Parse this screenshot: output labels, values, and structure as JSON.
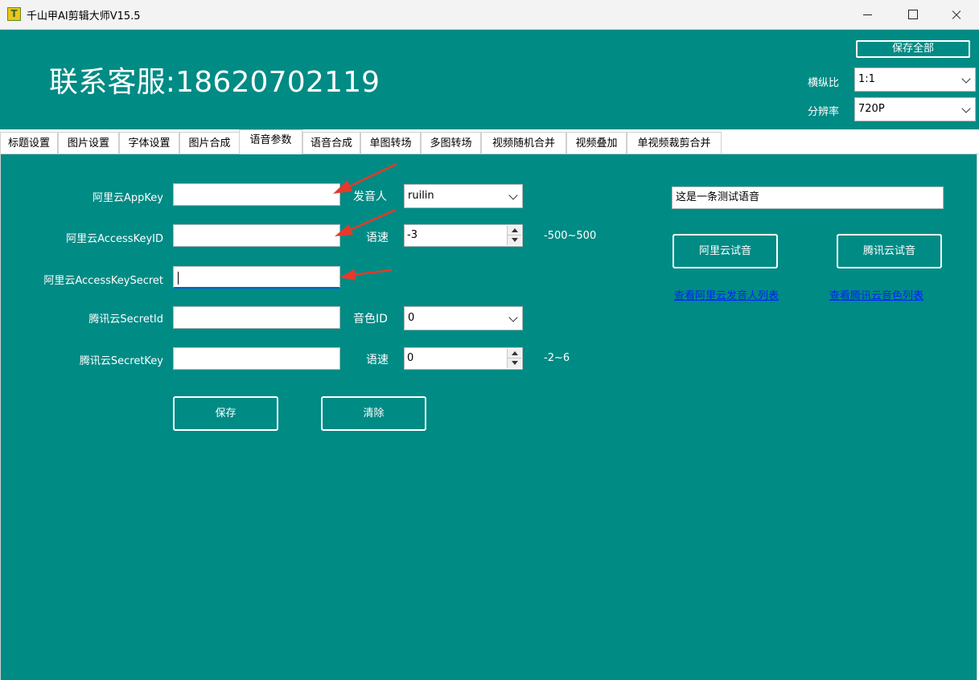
{
  "window": {
    "title": "千山甲AI剪辑大师V15.5",
    "icon_letter": "T"
  },
  "header": {
    "contact": "联系客服:18620702119",
    "save_all_label": "保存全部",
    "aspect_label": "横纵比",
    "aspect_value": "1:1",
    "resolution_label": "分辨率",
    "resolution_value": "720P"
  },
  "tabs": [
    {
      "label": "标题设置",
      "active": false
    },
    {
      "label": "图片设置",
      "active": false
    },
    {
      "label": "字体设置",
      "active": false
    },
    {
      "label": "图片合成",
      "active": false
    },
    {
      "label": "语音参数",
      "active": true
    },
    {
      "label": "语音合成",
      "active": false
    },
    {
      "label": "单图转场",
      "active": false
    },
    {
      "label": "多图转场",
      "active": false
    },
    {
      "label": "视频随机合并",
      "active": false
    },
    {
      "label": "视频叠加",
      "active": false
    },
    {
      "label": "单视频裁剪合并",
      "active": false
    }
  ],
  "form": {
    "aliyun_appkey_label": "阿里云AppKey",
    "aliyun_appkey_value": "",
    "aliyun_accesskeyid_label": "阿里云AccessKeyID",
    "aliyun_accesskeyid_value": "",
    "aliyun_accesskeysecret_label": "阿里云AccessKeySecret",
    "aliyun_accesskeysecret_value": "",
    "tencent_secretid_label": "腾讯云SecretId",
    "tencent_secretid_value": "",
    "tencent_secretkey_label": "腾讯云SecretKey",
    "tencent_secretkey_value": "",
    "speaker_label": "发音人",
    "speaker_value": "ruilin",
    "aliyun_speed_label": "语速",
    "aliyun_speed_value": "-3",
    "aliyun_speed_range": "-500~500",
    "voice_id_label": "音色ID",
    "voice_id_value": "0",
    "tencent_speed_label": "语速",
    "tencent_speed_value": "0",
    "tencent_speed_range": "-2~6",
    "save_label": "保存",
    "clear_label": "清除"
  },
  "test": {
    "text_value": "这是一条测试语音",
    "aliyun_try_label": "阿里云试音",
    "tencent_try_label": "腾讯云试音",
    "aliyun_list_link": "查看阿里云发音人列表",
    "tencent_list_link": "查看腾讯云音色列表"
  },
  "colors": {
    "teal": "#008b85",
    "annotation_arrow": "#e53a2a",
    "link": "#0020ff"
  }
}
